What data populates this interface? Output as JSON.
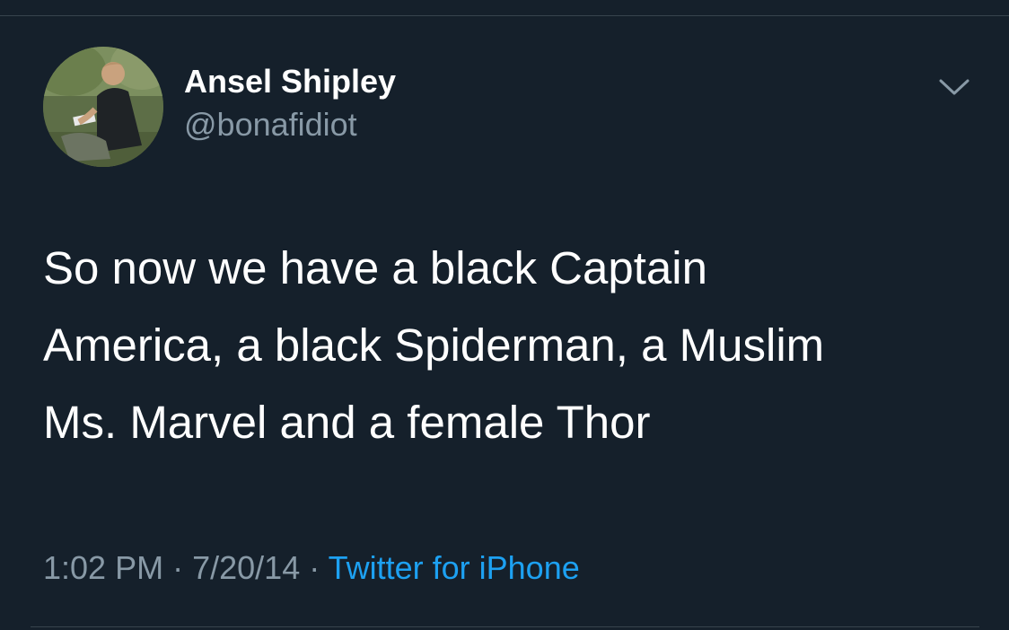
{
  "author": {
    "display_name": "Ansel Shipley",
    "handle": "@bonafidiot",
    "avatar_icon": "user-avatar-photo"
  },
  "tweet": {
    "text": "So now we have a black Captain\nAmerica, a black Spiderman, a Muslim\nMs. Marvel and a female Thor",
    "time": "1:02 PM",
    "separator": "·",
    "date": "7/20/14",
    "source": "Twitter for iPhone"
  },
  "icons": {
    "menu": "chevron-down-icon"
  },
  "colors": {
    "background": "#15202b",
    "primary_text": "#ffffff",
    "secondary_text": "#8899a6",
    "link": "#1da1f2",
    "divider": "#38444d"
  }
}
